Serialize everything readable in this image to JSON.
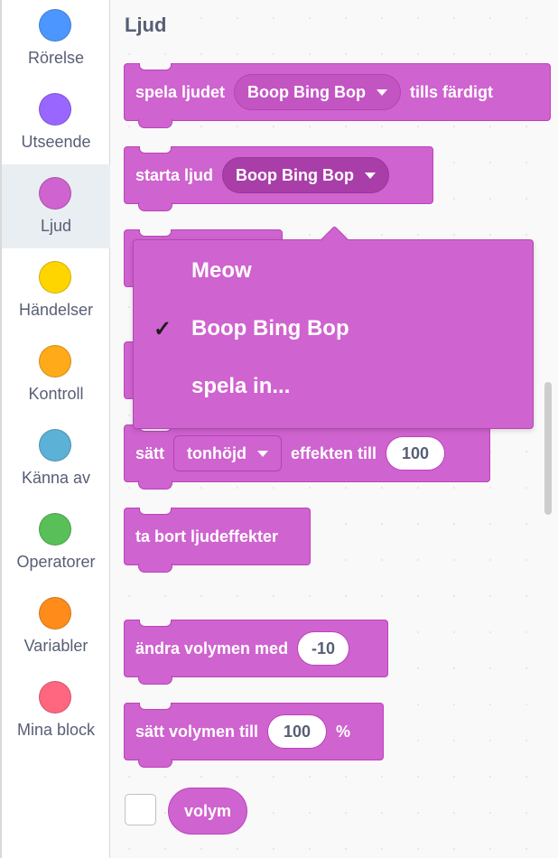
{
  "categories": [
    {
      "label": "Rörelse",
      "color": "#4c97ff",
      "selected": false
    },
    {
      "label": "Utseende",
      "color": "#9966ff",
      "selected": false
    },
    {
      "label": "Ljud",
      "color": "#cf63cf",
      "selected": true
    },
    {
      "label": "Händelser",
      "color": "#ffd500",
      "selected": false
    },
    {
      "label": "Kontroll",
      "color": "#ffab19",
      "selected": false
    },
    {
      "label": "Känna av",
      "color": "#5cb1d6",
      "selected": false
    },
    {
      "label": "Operatorer",
      "color": "#59c059",
      "selected": false
    },
    {
      "label": "Variabler",
      "color": "#ff8c1a",
      "selected": false
    },
    {
      "label": "Mina block",
      "color": "#ff6680",
      "selected": false
    }
  ],
  "palette": {
    "section_title": "Ljud",
    "blocks": {
      "play_until_done": {
        "text_before": "spela ljudet",
        "sound": "Boop Bing Bop",
        "text_after": "tills färdigt"
      },
      "start_sound": {
        "text": "starta ljud",
        "sound": "Boop Bing Bop"
      },
      "set_effect": {
        "text_before": "sätt",
        "effect": "tonhöjd",
        "text_mid": "effekten till",
        "value": "100"
      },
      "clear_effects": {
        "text": "ta bort ljudeffekter"
      },
      "change_volume": {
        "text": "ändra volymen med",
        "value": "-10"
      },
      "set_volume": {
        "text": "sätt volymen till",
        "value": "100",
        "unit": "%"
      },
      "volume_reporter": {
        "text": "volym"
      }
    }
  },
  "dropdown_menu": {
    "items": [
      {
        "label": "Meow",
        "checked": false
      },
      {
        "label": "Boop Bing Bop",
        "checked": true
      },
      {
        "label": "spela in...",
        "checked": false
      }
    ],
    "check_glyph": "✓"
  },
  "colors": {
    "sound_block": "#cf63cf",
    "sound_block_border": "#bd42bd",
    "category_text": "#575e75"
  }
}
